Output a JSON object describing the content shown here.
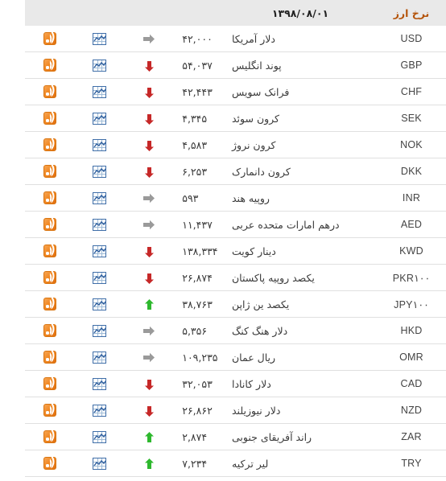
{
  "header": {
    "code_label": "نرخ ارز",
    "date_label": "۱۳۹۸/۰۸/۰۱",
    "blank_label": ""
  },
  "icons": {
    "rss": "rss-feed-icon",
    "chart": "chart-icon",
    "up": "arrow-up-icon",
    "down": "arrow-down-icon",
    "flat": "arrow-right-icon"
  },
  "colors": {
    "header_text": "#b4540a",
    "header_bg": "#e9e9e9",
    "up": "#2eb82e",
    "down": "#c62828",
    "flat": "#999999",
    "rss_orange": "#ef8722",
    "chart_blue": "#3f6ea8",
    "row_border": "#e0e0e0"
  },
  "rows": [
    {
      "code": "USD",
      "name": "دلار آمریکا",
      "value": "۴۲,۰۰۰",
      "trend": "flat"
    },
    {
      "code": "GBP",
      "name": "پوند انگلیس",
      "value": "۵۴,۰۳۷",
      "trend": "down"
    },
    {
      "code": "CHF",
      "name": "فرانک سویس",
      "value": "۴۲,۴۴۳",
      "trend": "down"
    },
    {
      "code": "SEK",
      "name": "کرون سوئد",
      "value": "۴,۳۴۵",
      "trend": "down"
    },
    {
      "code": "NOK",
      "name": "کرون نروژ",
      "value": "۴,۵۸۳",
      "trend": "down"
    },
    {
      "code": "DKK",
      "name": "کرون دانمارک",
      "value": "۶,۲۵۳",
      "trend": "down"
    },
    {
      "code": "INR",
      "name": "روپیه هند",
      "value": "۵۹۳",
      "trend": "flat"
    },
    {
      "code": "AED",
      "name": "درهم امارات متحده عربی",
      "value": "۱۱,۴۳۷",
      "trend": "flat"
    },
    {
      "code": "KWD",
      "name": "دینار کویت",
      "value": "۱۳۸,۳۳۴",
      "trend": "down"
    },
    {
      "code": "PKR۱۰۰",
      "name": "یکصد روپیه پاکستان",
      "value": "۲۶,۸۷۴",
      "trend": "down"
    },
    {
      "code": "JPY۱۰۰",
      "name": "یکصد ین ژاپن",
      "value": "۳۸,۷۶۳",
      "trend": "up"
    },
    {
      "code": "HKD",
      "name": "دلار هنگ کنگ",
      "value": "۵,۳۵۶",
      "trend": "flat"
    },
    {
      "code": "OMR",
      "name": "ریال عمان",
      "value": "۱۰۹,۲۳۵",
      "trend": "flat"
    },
    {
      "code": "CAD",
      "name": "دلار کانادا",
      "value": "۳۲,۰۵۳",
      "trend": "down"
    },
    {
      "code": "NZD",
      "name": "دلار نیوزیلند",
      "value": "۲۶,۸۶۲",
      "trend": "down"
    },
    {
      "code": "ZAR",
      "name": "راند آفریقای جنوبی",
      "value": "۲,۸۷۴",
      "trend": "up"
    },
    {
      "code": "TRY",
      "name": "لیر ترکیه",
      "value": "۷,۲۳۴",
      "trend": "up"
    }
  ]
}
